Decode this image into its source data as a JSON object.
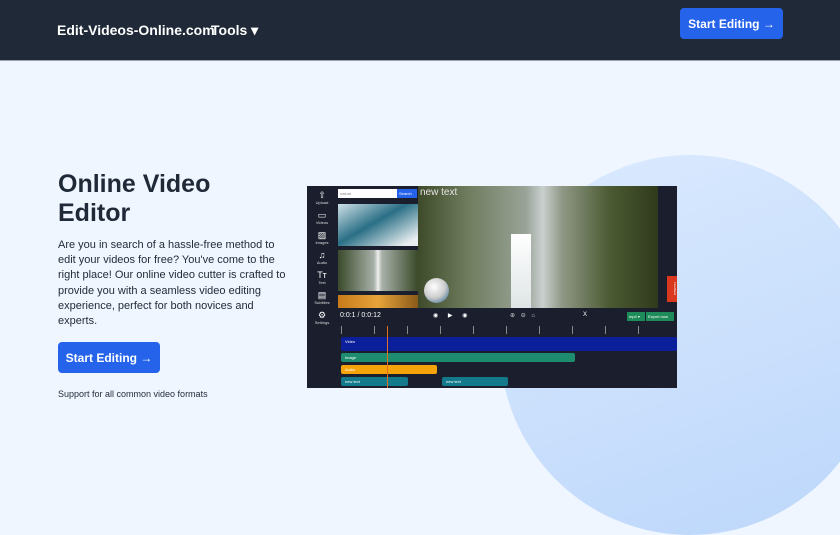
{
  "header": {
    "brand": "Edit-Videos-Online.com",
    "tools": "Tools ▾",
    "cta": "Start Editing →"
  },
  "hero": {
    "title": "Online Video Editor",
    "description": "Are you in search of a hassle-free method to edit your videos for free? You've come to the right place! Our online video cutter is crafted to provide you with a seamless video editing experience, perfect for both novices and experts.",
    "cta": "Start Editing →",
    "support": "Support for all common video formats"
  },
  "editor": {
    "sidebar": [
      {
        "icon": "⇧",
        "label": "Upload"
      },
      {
        "icon": "▭",
        "label": "Videos"
      },
      {
        "icon": "▨",
        "label": "Images"
      },
      {
        "icon": "♫",
        "label": "Audio"
      },
      {
        "icon": "Tт",
        "label": "Text"
      },
      {
        "icon": "▤",
        "label": "Subtitles"
      },
      {
        "icon": "⚙",
        "label": "Settings"
      }
    ],
    "search_value": "nature",
    "search_button": "Search",
    "overlay_text": "new text",
    "feedback": "Feedback",
    "time": "0:0:1 / 0:0:12",
    "format": "mp4 ▾",
    "export": "Export now",
    "close": "X",
    "tracks": {
      "video": "Video",
      "image": "Image",
      "audio": "Audio",
      "text1": "new text",
      "text2": "new text"
    }
  }
}
